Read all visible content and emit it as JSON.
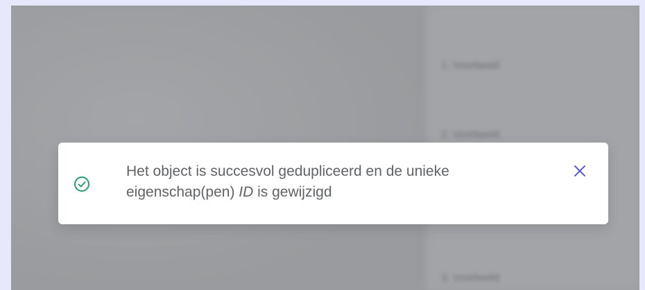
{
  "background": {
    "rows": [
      "1. Voorbeeld",
      "2. Voorbeeld",
      "3. Voorbeeld"
    ]
  },
  "toast": {
    "icon": "check-circle-icon",
    "message_part1": "Het object is succesvol gedupliceerd en de unieke eigenschap(pen) ",
    "message_emphasis": "ID",
    "message_part2": " is gewijzigd",
    "close_icon": "close-icon",
    "colors": {
      "success": "#22a06b",
      "close": "#5b5bd6",
      "text": "#606266"
    }
  }
}
